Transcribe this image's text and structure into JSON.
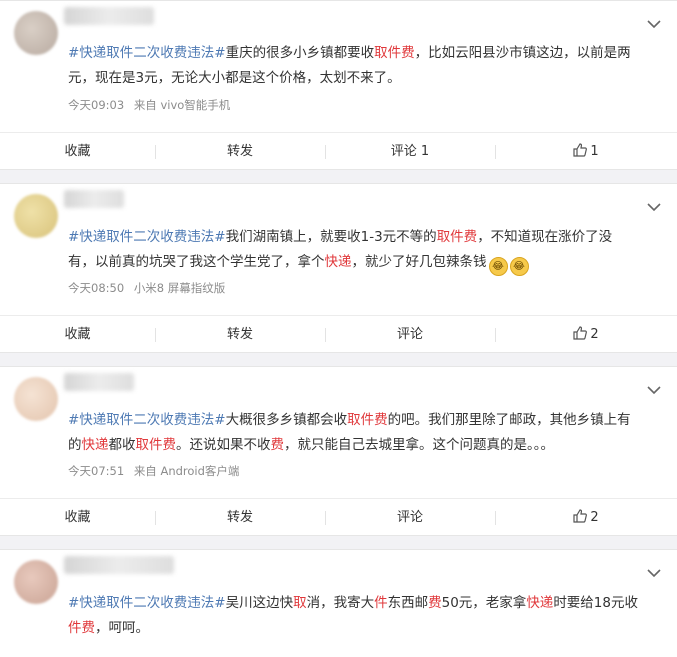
{
  "posts": [
    {
      "tag": "#快递取件二次收费违法#",
      "segments": [
        {
          "t": "重庆的很多小乡镇都要收",
          "c": ""
        },
        {
          "t": "取件费",
          "c": "hl"
        },
        {
          "t": "，比如云阳县沙市镇这边，以前是两元，现在是3元，无论大小都是这个价格，太划不来了。",
          "c": ""
        }
      ],
      "time": "今天09:03",
      "source": "来自 vivo智能手机",
      "actions": {
        "collect": "收藏",
        "repost": "转发",
        "comment": "评论 1",
        "like": "1"
      }
    },
    {
      "tag": "#快递取件二次收费违法#",
      "segments": [
        {
          "t": "我们湖南镇上，就要收1-3元不等的",
          "c": ""
        },
        {
          "t": "取件费",
          "c": "hl"
        },
        {
          "t": "，不知道现在涨价了没有，以前真的坑哭了我这个学生党了，拿个",
          "c": ""
        },
        {
          "t": "快递",
          "c": "hl"
        },
        {
          "t": "，就少了好几包辣条钱",
          "c": ""
        }
      ],
      "emojis": [
        "😂",
        "😂"
      ],
      "time": "今天08:50",
      "source": "小米8 屏幕指纹版",
      "actions": {
        "collect": "收藏",
        "repost": "转发",
        "comment": "评论",
        "like": "2"
      }
    },
    {
      "tag": "#快递取件二次收费违法#",
      "segments": [
        {
          "t": "大概很多乡镇都会收",
          "c": ""
        },
        {
          "t": "取件费",
          "c": "hl"
        },
        {
          "t": "的吧。我们那里除了邮政，其他乡镇上有的",
          "c": ""
        },
        {
          "t": "快递",
          "c": "hl"
        },
        {
          "t": "都收",
          "c": ""
        },
        {
          "t": "取件费",
          "c": "hl"
        },
        {
          "t": "。还说如果不收",
          "c": ""
        },
        {
          "t": "费",
          "c": "hl"
        },
        {
          "t": "，就只能自己去城里拿。这个问题真的是。。。",
          "c": ""
        }
      ],
      "time": "今天07:51",
      "source": "来自 Android客户端",
      "actions": {
        "collect": "收藏",
        "repost": "转发",
        "comment": "评论",
        "like": "2"
      }
    },
    {
      "tag": "#快递取件二次收费违法#",
      "segments": [
        {
          "t": "吴川这边快",
          "c": ""
        },
        {
          "t": "取",
          "c": "hl"
        },
        {
          "t": "消，我寄大",
          "c": ""
        },
        {
          "t": "件",
          "c": "hl"
        },
        {
          "t": "东西邮",
          "c": ""
        },
        {
          "t": "费",
          "c": "hl"
        },
        {
          "t": "50元，老家拿",
          "c": ""
        },
        {
          "t": "快递",
          "c": "hl"
        },
        {
          "t": "时要给18元收",
          "c": ""
        },
        {
          "t": "件费",
          "c": "hl"
        },
        {
          "t": "，呵呵。",
          "c": ""
        }
      ]
    }
  ],
  "colors": {
    "tag": "#4d79b3",
    "highlight": "#e0383b",
    "meta": "#8c8c8c",
    "background": "#f2f2f5"
  },
  "icons": {
    "menu": "chevron-down-icon",
    "like": "thumbs-up-icon"
  }
}
